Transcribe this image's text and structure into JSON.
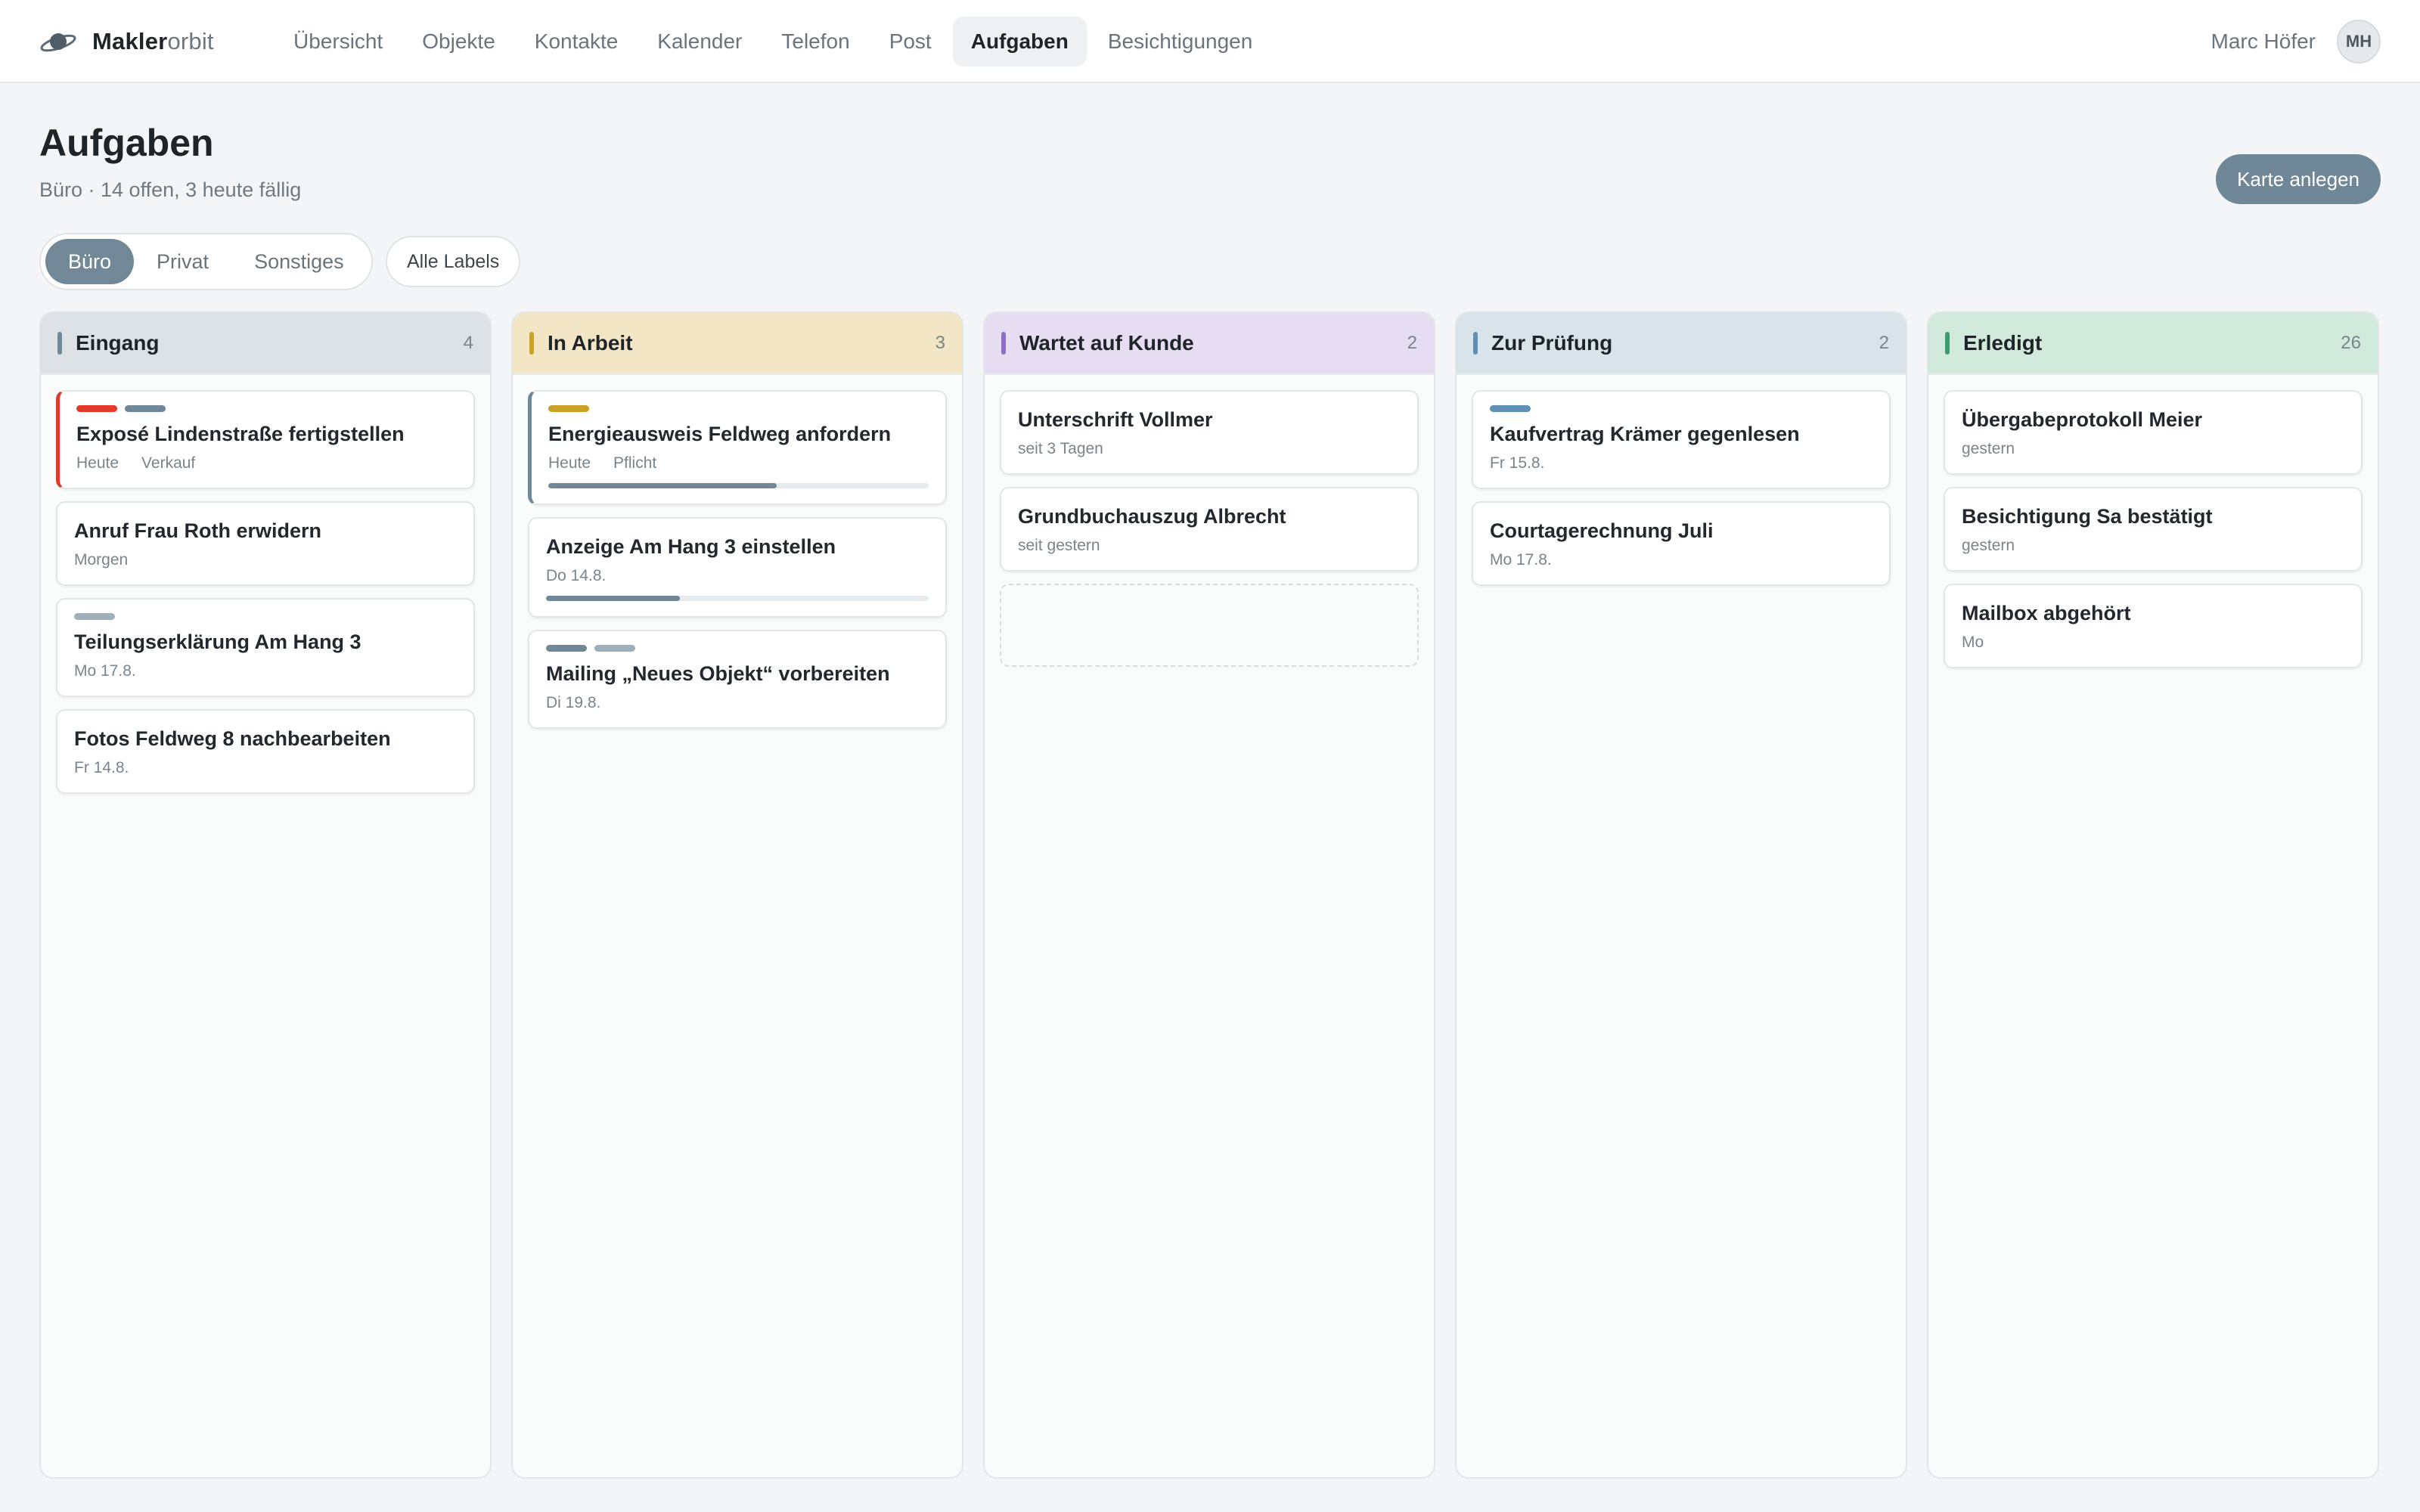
{
  "brand": {
    "bold": "Makler",
    "light": "orbit"
  },
  "nav": [
    {
      "label": "Übersicht",
      "active": false
    },
    {
      "label": "Objekte",
      "active": false
    },
    {
      "label": "Kontakte",
      "active": false
    },
    {
      "label": "Kalender",
      "active": false
    },
    {
      "label": "Telefon",
      "active": false
    },
    {
      "label": "Post",
      "active": false
    },
    {
      "label": "Aufgaben",
      "active": true
    },
    {
      "label": "Besichtigungen",
      "active": false
    }
  ],
  "user": {
    "name": "Marc Höfer",
    "initials": "MH"
  },
  "page": {
    "title": "Aufgaben",
    "subtitle": "Büro · 14 offen, 3 heute fällig",
    "create_label": "Karte anlegen"
  },
  "filters": {
    "segments": [
      {
        "label": "Büro",
        "active": true
      },
      {
        "label": "Privat",
        "active": false
      },
      {
        "label": "Sonstiges",
        "active": false
      }
    ],
    "labels_button": "Alle Labels"
  },
  "colors": {
    "red": "#e23a2a",
    "slate": "#6f8796",
    "slate_light": "#9fb0ba",
    "gold": "#c9a227",
    "purple": "#8c6fc4",
    "blue": "#5f8fb3",
    "green": "#3f9a6e"
  },
  "columns": [
    {
      "title": "Eingang",
      "count": "4",
      "bar": "#6f8796",
      "head_bg": "#dde2e6",
      "cards": [
        {
          "title": "Exposé Lindenstraße fertigstellen",
          "meta": [
            "Heute",
            "Verkauf"
          ],
          "tags": [
            "#e23a2a",
            "#6f8796"
          ],
          "accent": "red"
        },
        {
          "title": "Anruf Frau Roth erwidern",
          "meta": [
            "Morgen"
          ],
          "tags": []
        },
        {
          "title": "Teilungserklärung Am Hang 3",
          "meta": [
            "Mo 17.8."
          ],
          "tags": [
            "#9fb0ba"
          ]
        },
        {
          "title": "Fotos Feldweg 8 nachbearbeiten",
          "meta": [
            "Fr 14.8."
          ],
          "tags": []
        }
      ]
    },
    {
      "title": "In Arbeit",
      "count": "3",
      "bar": "#c9a227",
      "head_bg": "#f2e6c4",
      "cards": [
        {
          "title": "Energieausweis Feldweg anfordern",
          "meta": [
            "Heute",
            "Pflicht"
          ],
          "tags": [
            "#c9a227"
          ],
          "accent": "slate",
          "progress": 0.6
        },
        {
          "title": "Anzeige Am Hang 3 einstellen",
          "meta": [
            "Do 14.8."
          ],
          "tags": [],
          "progress": 0.35
        },
        {
          "title": "Mailing „Neues Objekt“ vorbereiten",
          "meta": [
            "Di 19.8."
          ],
          "tags": [
            "#6f8796",
            "#9fb0ba"
          ]
        }
      ]
    },
    {
      "title": "Wartet auf Kunde",
      "count": "2",
      "bar": "#8c6fc4",
      "head_bg": "#e6ddf2",
      "cards": [
        {
          "title": "Unterschrift Vollmer",
          "meta": [
            "seit 3 Tagen"
          ],
          "tags": []
        },
        {
          "title": "Grundbuchauszug Albrecht",
          "meta": [
            "seit gestern"
          ],
          "tags": []
        }
      ],
      "dropzone": true
    },
    {
      "title": "Zur Prüfung",
      "count": "2",
      "bar": "#5f8fb3",
      "head_bg": "#d9e4ea",
      "cards": [
        {
          "title": "Kaufvertrag Krämer gegenlesen",
          "meta": [
            "Fr 15.8."
          ],
          "tags": [
            "#5f8fb3"
          ]
        },
        {
          "title": "Courtagerechnung Juli",
          "meta": [
            "Mo 17.8."
          ],
          "tags": []
        }
      ]
    },
    {
      "title": "Erledigt",
      "count": "26",
      "bar": "#3f9a6e",
      "head_bg": "#d2eadb",
      "cards": [
        {
          "title": "Übergabeprotokoll Meier",
          "meta": [
            "gestern"
          ],
          "tags": []
        },
        {
          "title": "Besichtigung Sa bestätigt",
          "meta": [
            "gestern"
          ],
          "tags": []
        },
        {
          "title": "Mailbox abgehört",
          "meta": [
            "Mo"
          ],
          "tags": []
        }
      ]
    }
  ]
}
